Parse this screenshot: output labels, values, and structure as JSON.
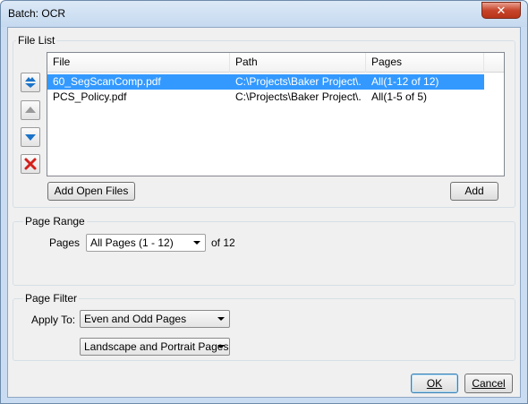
{
  "window": {
    "title": "Batch: OCR",
    "close_glyph": "✕"
  },
  "file_list": {
    "legend": "File List",
    "columns": [
      "File",
      "Path",
      "Pages"
    ],
    "rows": [
      {
        "file": "60_SegScanComp.pdf",
        "path": "C:\\Projects\\Baker Project\\...",
        "pages": "All(1-12 of 12)",
        "selected": true
      },
      {
        "file": "PCS_Policy.pdf",
        "path": "C:\\Projects\\Baker Project\\...",
        "pages": "All(1-5 of 5)",
        "selected": false
      }
    ],
    "add_open_files_label": "Add Open Files",
    "add_label": "Add",
    "side_buttons": [
      "move-to-top-icon",
      "move-up-icon",
      "move-down-icon",
      "remove-icon"
    ]
  },
  "page_range": {
    "legend": "Page Range",
    "pages_label": "Pages",
    "pages_value": "All Pages (1 - 12)",
    "of_total": "of 12"
  },
  "page_filter": {
    "legend": "Page Filter",
    "apply_to_label": "Apply To:",
    "parity_value": "Even and Odd Pages",
    "orientation_value": "Landscape and Portrait Pages"
  },
  "footer": {
    "ok_label": "OK",
    "cancel_label": "Cancel"
  },
  "colors": {
    "selection": "#3399ff",
    "title_bar": "#c5d9ef",
    "close_button": "#c7452b"
  }
}
